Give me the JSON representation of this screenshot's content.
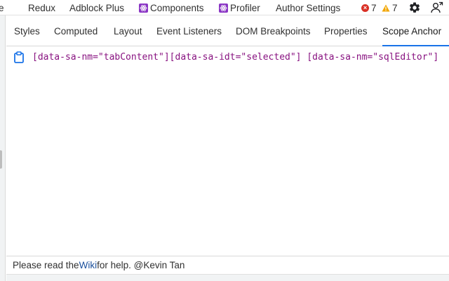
{
  "top_tabs": {
    "partial_label": "e",
    "redux": "Redux",
    "adblock": "Adblock Plus",
    "components": "Components",
    "profiler": "Profiler",
    "author_settings": "Author Settings"
  },
  "status": {
    "errors": "7",
    "warnings": "7",
    "error_color": "#d93025",
    "warning_color": "#f2a600"
  },
  "sub_tabs": {
    "styles": "Styles",
    "computed": "Computed",
    "layout": "Layout",
    "event_listeners": "Event Listeners",
    "dom_breakpoints": "DOM Breakpoints",
    "properties": "Properties",
    "scope_anchor": "Scope Anchor"
  },
  "content": {
    "selector": "[data-sa-nm=\"tabContent\"][data-sa-idt=\"selected\"] [data-sa-nm=\"sqlEditor\"]",
    "selector_color": "#881280"
  },
  "footer": {
    "prefix": "Please read the ",
    "wiki_link": "Wiki",
    "suffix": " for help. @Kevin Tan"
  },
  "icons": {
    "react": "react-icon",
    "settings": "gear-icon",
    "user": "user-switch-icon",
    "copy": "clipboard-icon"
  },
  "accent_color": "#1a73e8"
}
